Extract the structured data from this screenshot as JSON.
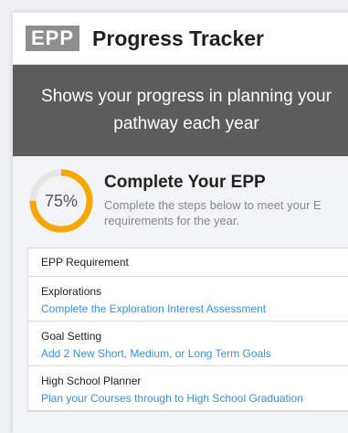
{
  "header": {
    "logo": "EPP",
    "title": "Progress Tracker"
  },
  "banner": {
    "text": "Shows your progress in planning your pathway each year"
  },
  "summary": {
    "percent_label": "75%",
    "percent_value": 0.75,
    "title": "Complete Your EPP",
    "description_line1": "Complete the steps below to meet your E",
    "description_line2": "requirements for the year."
  },
  "table": {
    "header": "EPP Requirement",
    "rows": [
      {
        "title": "Explorations",
        "link": "Complete the Exploration Interest Assessment"
      },
      {
        "title": "Goal Setting",
        "link": "Add 2 New Short, Medium, or Long Term Goals"
      },
      {
        "title": "High School Planner",
        "link": "Plan your Courses through to High School Graduation"
      }
    ]
  },
  "colors": {
    "ring_progress": "#f5a800",
    "ring_track": "#e6e6e6",
    "banner_bg": "#5c5c5c",
    "logo_bg": "#8e8e8e",
    "link": "#3d8fd6"
  }
}
